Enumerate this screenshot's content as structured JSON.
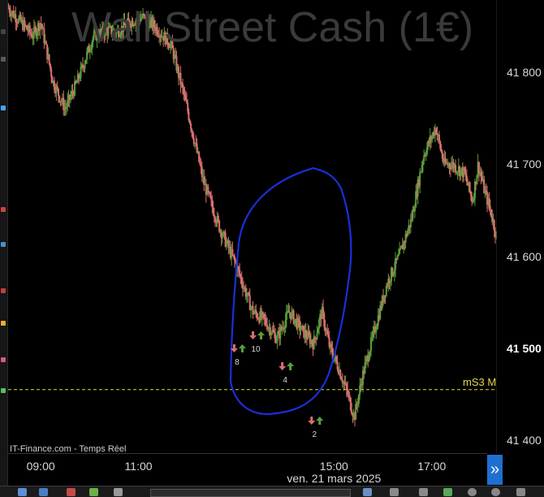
{
  "watermark": "Wall Street Cash (1€)",
  "source": "IT-Finance.com - Temps Réel",
  "level_label": "mS3 M",
  "date_label": "ven. 21 mars 2025",
  "colors": {
    "up": "#5a9e3a",
    "down": "#d97070",
    "level": "#e6d94a",
    "annotation": "#1a2fd9",
    "accent": "#1f6fd1"
  },
  "icons": {
    "scroll_right": "»"
  },
  "chart_data": {
    "type": "candlestick",
    "title": "Wall Street Cash (1€)",
    "xlabel": "ven. 21 mars 2025",
    "x_ticks": [
      "09:00",
      "11:00",
      "15:00",
      "17:00"
    ],
    "y_ticks": [
      {
        "value": 41800,
        "label": "41 800"
      },
      {
        "value": 41700,
        "label": "41 700"
      },
      {
        "value": 41600,
        "label": "41 600"
      },
      {
        "value": 41500,
        "label": "41 500",
        "current": true
      },
      {
        "value": 41400,
        "label": "41 400"
      }
    ],
    "ylim": [
      41390,
      41875
    ],
    "time_range": [
      "08:20",
      "18:20"
    ],
    "price_path": [
      [
        "08:20",
        41870
      ],
      [
        "08:50",
        41840
      ],
      [
        "09:00",
        41855
      ],
      [
        "09:15",
        41790
      ],
      [
        "09:30",
        41760
      ],
      [
        "09:45",
        41790
      ],
      [
        "10:05",
        41840
      ],
      [
        "10:20",
        41845
      ],
      [
        "10:35",
        41845
      ],
      [
        "10:50",
        41855
      ],
      [
        "11:05",
        41860
      ],
      [
        "11:20",
        41850
      ],
      [
        "11:40",
        41830
      ],
      [
        "12:00",
        41760
      ],
      [
        "12:20",
        41680
      ],
      [
        "12:40",
        41630
      ],
      [
        "13:00",
        41590
      ],
      [
        "13:20",
        41540
      ],
      [
        "13:35",
        41530
      ],
      [
        "13:50",
        41510
      ],
      [
        "14:05",
        41540
      ],
      [
        "14:20",
        41520
      ],
      [
        "14:35",
        41505
      ],
      [
        "14:45",
        41540
      ],
      [
        "14:55",
        41500
      ],
      [
        "15:05",
        41480
      ],
      [
        "15:15",
        41455
      ],
      [
        "15:25",
        41425
      ],
      [
        "15:35",
        41470
      ],
      [
        "15:50",
        41520
      ],
      [
        "16:05",
        41570
      ],
      [
        "16:20",
        41600
      ],
      [
        "16:35",
        41640
      ],
      [
        "16:50",
        41710
      ],
      [
        "17:05",
        41740
      ],
      [
        "17:15",
        41700
      ],
      [
        "17:25",
        41700
      ],
      [
        "17:40",
        41690
      ],
      [
        "17:50",
        41660
      ],
      [
        "17:57",
        41700
      ],
      [
        "18:05",
        41670
      ],
      [
        "18:12",
        41650
      ],
      [
        "18:20",
        41620
      ]
    ],
    "reference_lines": [
      {
        "value": 41455,
        "label": "mS3 M",
        "style": "dashed"
      }
    ],
    "signals": [
      {
        "time": "13:05",
        "label": "8",
        "direction": "down-up"
      },
      {
        "time": "13:28",
        "label": "10",
        "direction": "down-up"
      },
      {
        "time": "14:04",
        "label": "4",
        "direction": "down-up"
      },
      {
        "time": "14:40",
        "label": "2",
        "direction": "down-up"
      }
    ],
    "grid": false,
    "annotation": "freehand blue loop"
  }
}
